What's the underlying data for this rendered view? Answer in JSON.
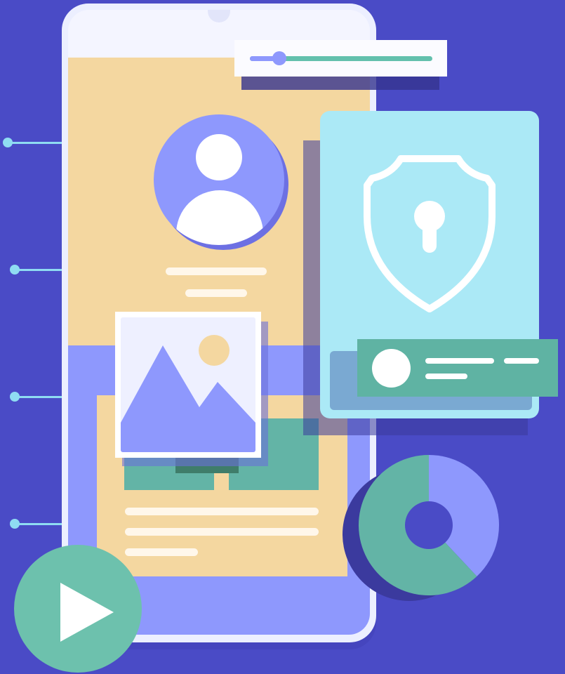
{
  "colors": {
    "background": "#4a4bc6",
    "phone_frame": "#ecefff",
    "screen_tan": "#f4d7a0",
    "screen_blue": "#8e98fd",
    "teal": "#63b4a6",
    "shield_card": "#abe9f6",
    "connector": "#8fdcf2",
    "sun": "#f4d7a0"
  },
  "illustration": {
    "slider": {
      "value_fraction": 0.16
    },
    "donut": {
      "segments": [
        {
          "color": "#8e98fd",
          "fraction": 0.38
        },
        {
          "color": "#63b4a6",
          "fraction": 0.62
        }
      ]
    },
    "icons": [
      "user-icon",
      "image-icon",
      "shield-lock-icon",
      "play-icon"
    ]
  }
}
